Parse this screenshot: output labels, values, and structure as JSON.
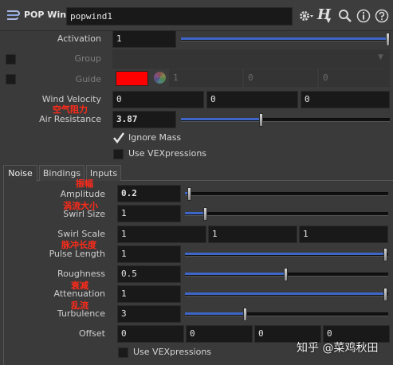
{
  "header": {
    "node_type": "POP Wind",
    "node_name": "popwind1",
    "help_icon_letter": "H"
  },
  "params": {
    "activation": {
      "label": "Activation",
      "value": "1",
      "slider": 1.0
    },
    "group": {
      "label": "Group"
    },
    "guide": {
      "label": "Guide",
      "values": [
        "1",
        "0",
        "0"
      ]
    },
    "wind_velocity": {
      "label": "Wind Velocity",
      "values": [
        "0",
        "0",
        "0"
      ]
    },
    "air_resistance": {
      "label": "Air Resistance",
      "annotation": "空气阻力",
      "value": "3.87",
      "slider": 0.387
    },
    "ignore_mass": {
      "label": "Ignore Mass",
      "checked": true
    },
    "use_vex_top": {
      "label": "Use VEXpressions",
      "checked": false
    }
  },
  "tabs": [
    "Noise",
    "Bindings",
    "Inputs"
  ],
  "noise": {
    "amplitude": {
      "label": "Amplitude",
      "annotation": "振幅",
      "value": "0.2",
      "slider": 0.02
    },
    "swirl_size": {
      "label": "Swirl Size",
      "annotation": "涡流大小",
      "value": "1",
      "slider": 0.1
    },
    "swirl_scale": {
      "label": "Swirl Scale",
      "values": [
        "1",
        "1",
        "1"
      ]
    },
    "pulse_length": {
      "label": "Pulse Length",
      "annotation": "脉冲长度",
      "value": "1",
      "slider": 1.0
    },
    "roughness": {
      "label": "Roughness",
      "value": "0.5",
      "slider": 0.5
    },
    "attenuation": {
      "label": "Attenuation",
      "annotation": "衰减",
      "value": "1",
      "slider": 1.0
    },
    "turbulence": {
      "label": "Turbulence",
      "annotation": "乱流",
      "value": "3",
      "slider": 0.3
    },
    "offset": {
      "label": "Offset",
      "values": [
        "0",
        "0",
        "0",
        "0"
      ]
    },
    "use_vex": {
      "label": "Use VEXpressions",
      "checked": false
    }
  },
  "watermark": "知乎 @菜鸡秋田",
  "colors": {
    "accent": "#3d66c6",
    "guide_color": "#ff0000",
    "annotation": "#ff2a1a"
  }
}
